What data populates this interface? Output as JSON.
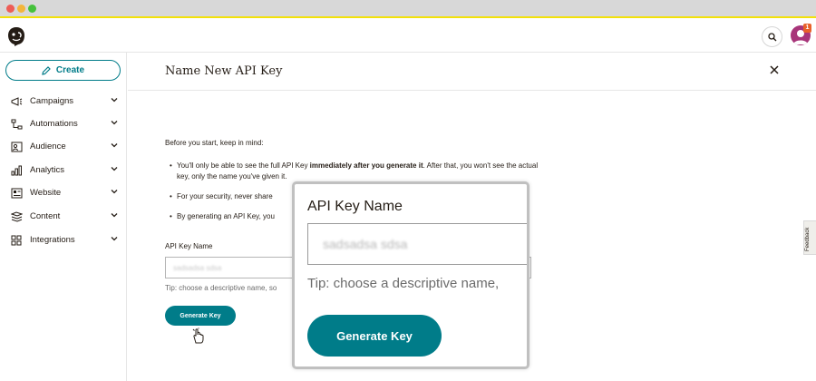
{
  "window": {
    "controls": [
      "close",
      "minimize",
      "maximize"
    ]
  },
  "header": {
    "logo_icon": "mailchimp-logo-icon",
    "search_icon": "search-icon",
    "notification_count": "1"
  },
  "sidebar": {
    "create_label": "Create",
    "items": [
      {
        "label": "Campaigns",
        "icon": "megaphone-icon"
      },
      {
        "label": "Automations",
        "icon": "automations-icon"
      },
      {
        "label": "Audience",
        "icon": "audience-icon"
      },
      {
        "label": "Analytics",
        "icon": "bar-chart-icon"
      },
      {
        "label": "Website",
        "icon": "website-icon"
      },
      {
        "label": "Content",
        "icon": "content-icon"
      },
      {
        "label": "Integrations",
        "icon": "grid-icon"
      }
    ]
  },
  "main": {
    "title": "Name New API Key",
    "intro": "Before you start, keep in mind:",
    "bullet1_prefix": "You'll only be able to see the full API Key ",
    "bullet1_bold": "immediately after you generate it",
    "bullet1_suffix": ". After that, you won't see the actual key, only the name you've given it.",
    "bullet2": "For your security, never share",
    "bullet3": "By generating an API Key, you",
    "field_label": "API Key Name",
    "field_value": "sadsadsa sdsa",
    "tip": "Tip: choose a descriptive name, so",
    "generate_label": "Generate Key"
  },
  "zoom": {
    "label": "API Key Name",
    "value": "sadsadsa sdsa",
    "tip": "Tip: choose a descriptive name,",
    "generate_label": "Generate Key"
  },
  "feedback_label": "Feedback",
  "colors": {
    "accent": "#007c89",
    "chrome_border": "#f2e10a",
    "text": "#241c15"
  }
}
